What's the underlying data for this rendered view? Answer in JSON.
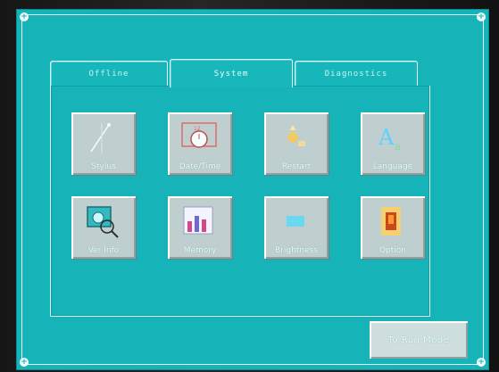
{
  "tabs": [
    {
      "label": "Offline",
      "active": false
    },
    {
      "label": "System",
      "active": true
    },
    {
      "label": "Diagnostics",
      "active": false
    }
  ],
  "icons": [
    {
      "label": "Stylus",
      "icon": "stylus-icon"
    },
    {
      "label": "Date/Time",
      "icon": "clock-icon"
    },
    {
      "label": "Restart",
      "icon": "restart-icon"
    },
    {
      "label": "Language",
      "icon": "language-icon"
    },
    {
      "label": "Ver Info",
      "icon": "info-icon"
    },
    {
      "label": "Memory",
      "icon": "memory-icon"
    },
    {
      "label": "Brightness",
      "icon": "brightness-icon"
    },
    {
      "label": "Option",
      "icon": "option-icon"
    }
  ],
  "footer": {
    "run_mode_label": "To Run Mode"
  },
  "colors": {
    "screen": "#16b4b8",
    "button": "#bfcfd0",
    "border": "#e8ffff"
  }
}
